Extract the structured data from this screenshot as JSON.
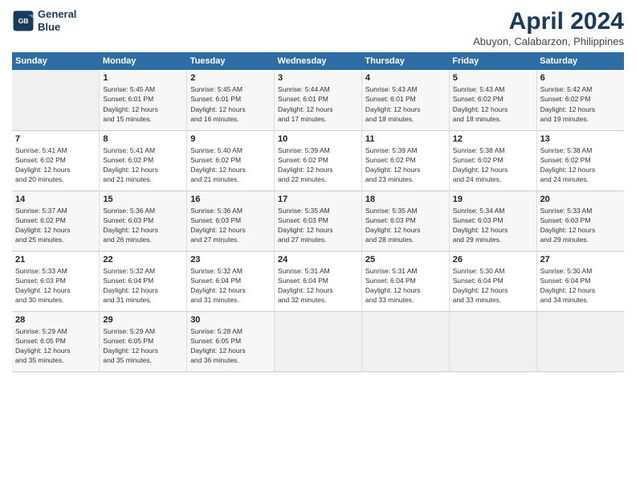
{
  "header": {
    "logo_line1": "General",
    "logo_line2": "Blue",
    "month": "April 2024",
    "location": "Abuyon, Calabarzon, Philippines"
  },
  "days_of_week": [
    "Sunday",
    "Monday",
    "Tuesday",
    "Wednesday",
    "Thursday",
    "Friday",
    "Saturday"
  ],
  "weeks": [
    [
      {
        "day": "",
        "info": ""
      },
      {
        "day": "1",
        "info": "Sunrise: 5:45 AM\nSunset: 6:01 PM\nDaylight: 12 hours\nand 15 minutes."
      },
      {
        "day": "2",
        "info": "Sunrise: 5:45 AM\nSunset: 6:01 PM\nDaylight: 12 hours\nand 16 minutes."
      },
      {
        "day": "3",
        "info": "Sunrise: 5:44 AM\nSunset: 6:01 PM\nDaylight: 12 hours\nand 17 minutes."
      },
      {
        "day": "4",
        "info": "Sunrise: 5:43 AM\nSunset: 6:01 PM\nDaylight: 12 hours\nand 18 minutes."
      },
      {
        "day": "5",
        "info": "Sunrise: 5:43 AM\nSunset: 6:02 PM\nDaylight: 12 hours\nand 18 minutes."
      },
      {
        "day": "6",
        "info": "Sunrise: 5:42 AM\nSunset: 6:02 PM\nDaylight: 12 hours\nand 19 minutes."
      }
    ],
    [
      {
        "day": "7",
        "info": "Sunrise: 5:41 AM\nSunset: 6:02 PM\nDaylight: 12 hours\nand 20 minutes."
      },
      {
        "day": "8",
        "info": "Sunrise: 5:41 AM\nSunset: 6:02 PM\nDaylight: 12 hours\nand 21 minutes."
      },
      {
        "day": "9",
        "info": "Sunrise: 5:40 AM\nSunset: 6:02 PM\nDaylight: 12 hours\nand 21 minutes."
      },
      {
        "day": "10",
        "info": "Sunrise: 5:39 AM\nSunset: 6:02 PM\nDaylight: 12 hours\nand 22 minutes."
      },
      {
        "day": "11",
        "info": "Sunrise: 5:39 AM\nSunset: 6:02 PM\nDaylight: 12 hours\nand 23 minutes."
      },
      {
        "day": "12",
        "info": "Sunrise: 5:38 AM\nSunset: 6:02 PM\nDaylight: 12 hours\nand 24 minutes."
      },
      {
        "day": "13",
        "info": "Sunrise: 5:38 AM\nSunset: 6:02 PM\nDaylight: 12 hours\nand 24 minutes."
      }
    ],
    [
      {
        "day": "14",
        "info": "Sunrise: 5:37 AM\nSunset: 6:02 PM\nDaylight: 12 hours\nand 25 minutes."
      },
      {
        "day": "15",
        "info": "Sunrise: 5:36 AM\nSunset: 6:03 PM\nDaylight: 12 hours\nand 26 minutes."
      },
      {
        "day": "16",
        "info": "Sunrise: 5:36 AM\nSunset: 6:03 PM\nDaylight: 12 hours\nand 27 minutes."
      },
      {
        "day": "17",
        "info": "Sunrise: 5:35 AM\nSunset: 6:03 PM\nDaylight: 12 hours\nand 27 minutes."
      },
      {
        "day": "18",
        "info": "Sunrise: 5:35 AM\nSunset: 6:03 PM\nDaylight: 12 hours\nand 28 minutes."
      },
      {
        "day": "19",
        "info": "Sunrise: 5:34 AM\nSunset: 6:03 PM\nDaylight: 12 hours\nand 29 minutes."
      },
      {
        "day": "20",
        "info": "Sunrise: 5:33 AM\nSunset: 6:03 PM\nDaylight: 12 hours\nand 29 minutes."
      }
    ],
    [
      {
        "day": "21",
        "info": "Sunrise: 5:33 AM\nSunset: 6:03 PM\nDaylight: 12 hours\nand 30 minutes."
      },
      {
        "day": "22",
        "info": "Sunrise: 5:32 AM\nSunset: 6:04 PM\nDaylight: 12 hours\nand 31 minutes."
      },
      {
        "day": "23",
        "info": "Sunrise: 5:32 AM\nSunset: 6:04 PM\nDaylight: 12 hours\nand 31 minutes."
      },
      {
        "day": "24",
        "info": "Sunrise: 5:31 AM\nSunset: 6:04 PM\nDaylight: 12 hours\nand 32 minutes."
      },
      {
        "day": "25",
        "info": "Sunrise: 5:31 AM\nSunset: 6:04 PM\nDaylight: 12 hours\nand 33 minutes."
      },
      {
        "day": "26",
        "info": "Sunrise: 5:30 AM\nSunset: 6:04 PM\nDaylight: 12 hours\nand 33 minutes."
      },
      {
        "day": "27",
        "info": "Sunrise: 5:30 AM\nSunset: 6:04 PM\nDaylight: 12 hours\nand 34 minutes."
      }
    ],
    [
      {
        "day": "28",
        "info": "Sunrise: 5:29 AM\nSunset: 6:05 PM\nDaylight: 12 hours\nand 35 minutes."
      },
      {
        "day": "29",
        "info": "Sunrise: 5:29 AM\nSunset: 6:05 PM\nDaylight: 12 hours\nand 35 minutes."
      },
      {
        "day": "30",
        "info": "Sunrise: 5:28 AM\nSunset: 6:05 PM\nDaylight: 12 hours\nand 36 minutes."
      },
      {
        "day": "",
        "info": ""
      },
      {
        "day": "",
        "info": ""
      },
      {
        "day": "",
        "info": ""
      },
      {
        "day": "",
        "info": ""
      }
    ]
  ]
}
